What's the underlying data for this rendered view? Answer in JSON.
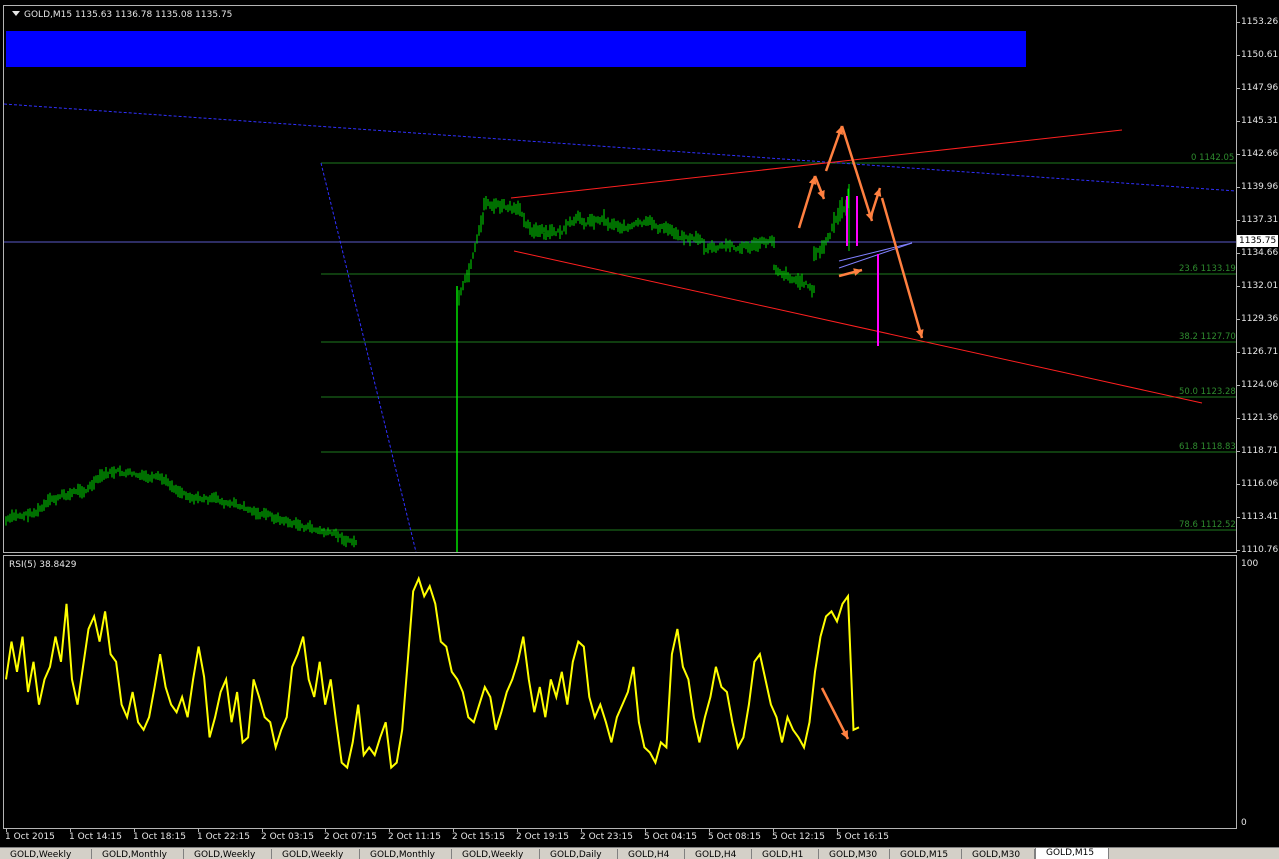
{
  "chart": {
    "symbol_title": "GOLD,M15  1135.63 1136.78 1135.08 1135.75",
    "current_price": "1135.75",
    "price_ticks": [
      "1153.26",
      "1150.61",
      "1147.96",
      "1145.31",
      "1142.66",
      "1139.96",
      "1137.31",
      "1134.66",
      "1132.01",
      "1129.36",
      "1126.71",
      "1124.06",
      "1121.36",
      "1118.71",
      "1116.06",
      "1113.41",
      "1110.76"
    ],
    "time_ticks": [
      "1 Oct 2015",
      "1 Oct 14:15",
      "1 Oct 18:15",
      "1 Oct 22:15",
      "2 Oct 03:15",
      "2 Oct 07:15",
      "2 Oct 11:15",
      "2 Oct 15:15",
      "2 Oct 19:15",
      "2 Oct 23:15",
      "5 Oct 04:15",
      "5 Oct 08:15",
      "5 Oct 12:15",
      "5 Oct 16:15"
    ],
    "fibonacci_levels": [
      {
        "label": "0 1142.05"
      },
      {
        "label": "23.6 1133.19"
      },
      {
        "label": "38.2 1127.70"
      },
      {
        "label": "50.0 1123.28"
      },
      {
        "label": "61.8 1118.83"
      },
      {
        "label": "78.6 1112.52"
      }
    ],
    "colors": {
      "background": "#000000",
      "candles": "#00e000",
      "resistance": "#ff2020",
      "trendline": "#3030ff",
      "fibonacci": "#1e7a1e",
      "arrows": "#ff8040",
      "magenta": "#ff00ff",
      "rsi_line": "#ffff00",
      "highlight_bar": "#0000ff"
    }
  },
  "rsi": {
    "title": "RSI(5) 38.8429",
    "scale_top": "100",
    "scale_bottom": "0"
  },
  "tabs": [
    {
      "label": "GOLD,Weekly",
      "active": false
    },
    {
      "label": "GOLD,Monthly",
      "active": false
    },
    {
      "label": "GOLD,Weekly",
      "active": false
    },
    {
      "label": "GOLD,Weekly",
      "active": false
    },
    {
      "label": "GOLD,Monthly",
      "active": false
    },
    {
      "label": "GOLD,Weekly",
      "active": false
    },
    {
      "label": "GOLD,Daily",
      "active": false
    },
    {
      "label": "GOLD,H4",
      "active": false
    },
    {
      "label": "GOLD,H4",
      "active": false
    },
    {
      "label": "GOLD,H1",
      "active": false
    },
    {
      "label": "GOLD,M30",
      "active": false
    },
    {
      "label": "GOLD,M15",
      "active": false
    },
    {
      "label": "GOLD,M30",
      "active": false
    },
    {
      "label": "GOLD,M15",
      "active": true
    }
  ]
}
